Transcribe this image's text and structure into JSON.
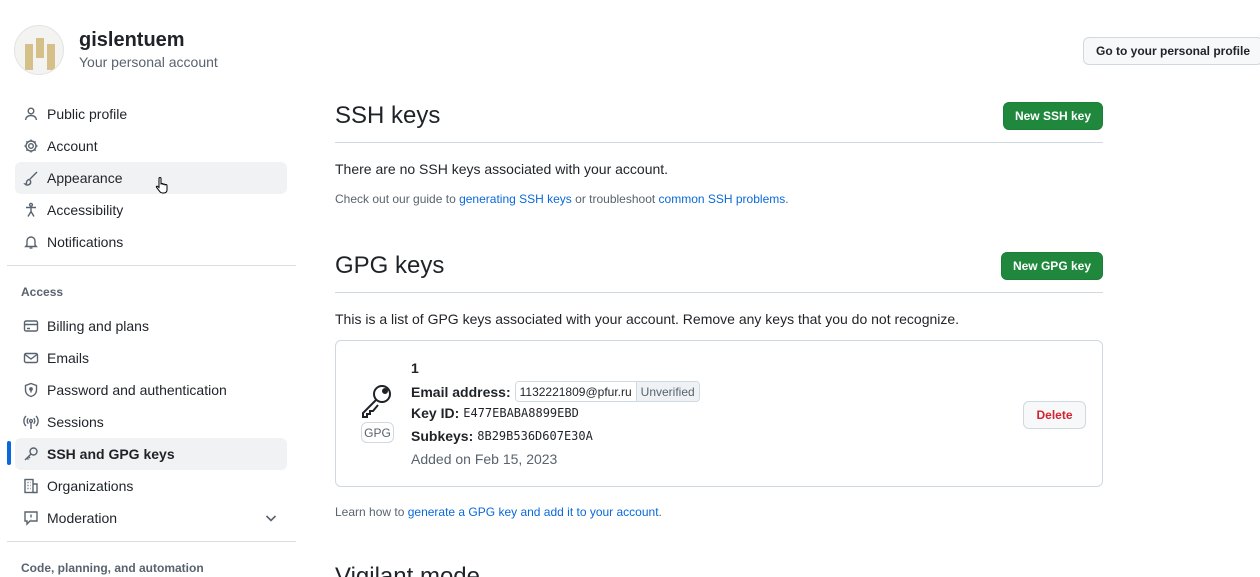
{
  "account": {
    "username": "gislentuem",
    "subtitle": "Your personal account",
    "profile_button": "Go to your personal profile"
  },
  "sidebar": {
    "items": [
      {
        "label": "Public profile",
        "icon": "person-icon"
      },
      {
        "label": "Account",
        "icon": "gear-icon"
      },
      {
        "label": "Appearance",
        "icon": "paintbrush-icon"
      },
      {
        "label": "Accessibility",
        "icon": "accessibility-icon"
      },
      {
        "label": "Notifications",
        "icon": "bell-icon"
      }
    ],
    "access_heading": "Access",
    "access_items": [
      {
        "label": "Billing and plans",
        "icon": "credit-card-icon"
      },
      {
        "label": "Emails",
        "icon": "mail-icon"
      },
      {
        "label": "Password and authentication",
        "icon": "shield-lock-icon"
      },
      {
        "label": "Sessions",
        "icon": "broadcast-icon"
      },
      {
        "label": "SSH and GPG keys",
        "icon": "key-icon",
        "selected": true
      },
      {
        "label": "Organizations",
        "icon": "organization-icon"
      },
      {
        "label": "Moderation",
        "icon": "report-icon",
        "expandable": true
      }
    ],
    "code_heading": "Code, planning, and automation"
  },
  "ssh": {
    "title": "SSH keys",
    "new_button": "New SSH key",
    "empty_text": "There are no SSH keys associated with your account.",
    "guide_prefix": "Check out our guide to ",
    "guide_link": "generating SSH keys",
    "guide_middle": " or troubleshoot ",
    "guide_link2": "common SSH problems",
    "guide_suffix": "."
  },
  "gpg": {
    "title": "GPG keys",
    "new_button": "New GPG key",
    "description": "This is a list of GPG keys associated with your account. Remove any keys that you do not recognize.",
    "key": {
      "badge": "GPG",
      "name": "1",
      "email_label": "Email address:",
      "email": "1132221809@pfur.ru",
      "email_status": "Unverified",
      "keyid_label": "Key ID:",
      "keyid": "E477EBABA8899EBD",
      "subkeys_label": "Subkeys:",
      "subkeys": "8B29B536D607E30A",
      "added": "Added on Feb 15, 2023",
      "delete_button": "Delete"
    },
    "learn_prefix": "Learn how to ",
    "learn_link": "generate a GPG key and add it to your account",
    "learn_suffix": "."
  },
  "vigilant": {
    "title": "Vigilant mode"
  },
  "colors": {
    "accent": "#0969da",
    "primary_button": "#1f883d",
    "danger": "#d1242f"
  }
}
